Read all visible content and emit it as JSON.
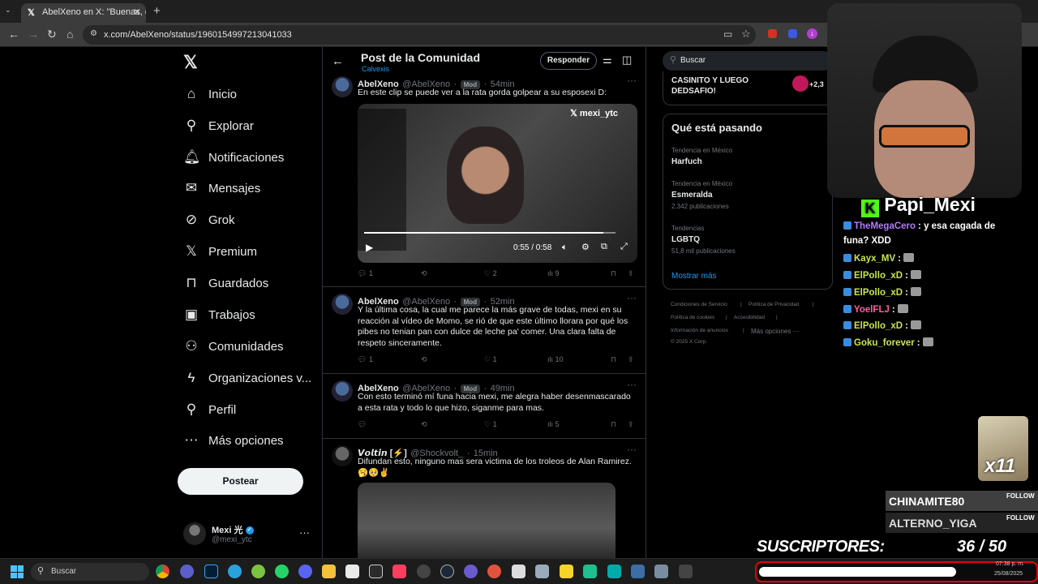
{
  "browser": {
    "tab_title": "AbelXeno en X: \"Buenas, q",
    "url": "x.com/AbelXeno/status/1960154997213041033"
  },
  "nav": {
    "items": [
      {
        "label": "Inicio",
        "icon": "home-icon",
        "glyph": "⌂"
      },
      {
        "label": "Explorar",
        "icon": "search-icon",
        "glyph": "⚲"
      },
      {
        "label": "Notificaciones",
        "icon": "bell-icon",
        "glyph": "🔔︎"
      },
      {
        "label": "Mensajes",
        "icon": "mail-icon",
        "glyph": "✉"
      },
      {
        "label": "Grok",
        "icon": "grok-icon",
        "glyph": "⊘"
      },
      {
        "label": "Premium",
        "icon": "x-logo-icon",
        "glyph": "𝕏"
      },
      {
        "label": "Guardados",
        "icon": "bookmark-icon",
        "glyph": "⊓"
      },
      {
        "label": "Trabajos",
        "icon": "briefcase-icon",
        "glyph": "▣"
      },
      {
        "label": "Comunidades",
        "icon": "people-icon",
        "glyph": "⚇"
      },
      {
        "label": "Organizaciones v...",
        "icon": "lightning-icon",
        "glyph": "ϟ"
      },
      {
        "label": "Perfil",
        "icon": "person-icon",
        "glyph": "⚲"
      },
      {
        "label": "Más opciones",
        "icon": "more-circle-icon",
        "glyph": "⋯"
      }
    ],
    "post_button": "Postear",
    "account_name": "Mexi 光",
    "account_handle": "@mexi_ytc"
  },
  "header": {
    "title": "Post de la Comunidad",
    "community": "Calvexis",
    "reply_button": "Responder"
  },
  "posts": [
    {
      "name": "AbelXeno",
      "handle": "@AbelXeno",
      "badge": "Mod",
      "time": "54min",
      "text": "En este clip se puede ver a la rata gorda golpear a su esposexi D:",
      "video_watermark": "mexi_ytc",
      "video_time": "0:55 / 0:58",
      "video_progress": 0.95,
      "replies": "1",
      "retweets": "",
      "likes": "2",
      "views": "9"
    },
    {
      "name": "AbelXeno",
      "handle": "@AbelXeno",
      "badge": "Mod",
      "time": "52min",
      "text": "Y la última cosa, la cual me parece la más grave de todas, mexi en su reacción al vídeo de Momo, se rió de que este último llorara por qué los pibes no tenian pan con dulce de leche pa' comer. Una clara falta de respeto sinceramente.",
      "replies": "1",
      "retweets": "",
      "likes": "1",
      "views": "10"
    },
    {
      "name": "AbelXeno",
      "handle": "@AbelXeno",
      "badge": "Mod",
      "time": "49min",
      "text": "Con esto terminó mí funa hacia mexi, me alegra haber desenmascarado a esta rata y todo lo que hizo, siganme para mas.",
      "replies": "",
      "retweets": "",
      "likes": "1",
      "views": "5"
    },
    {
      "name": "𝙑𝙤𝙡𝙩𝙞𝙣 [⚡]",
      "handle": "@Shockvolt_",
      "time": "15min",
      "text": "Difundan esto, ninguno mas sera victima de los troleos de Alan Ramirez. 🥱🥺✌"
    }
  ],
  "right": {
    "search_placeholder": "Buscar",
    "promo_text_1": "CASINITO Y LUEGO",
    "promo_text_2": "DEDSAFIO!",
    "promo_count": "+2,3",
    "trends_title": "Qué está pasando",
    "trends": [
      {
        "context": "Tendencia en México",
        "name": "Harfuch",
        "count": ""
      },
      {
        "context": "Tendencia en México",
        "name": "Esmeralda",
        "count": "2.342 publicaciones"
      },
      {
        "context": "Tendencias",
        "name": "LGBTQ",
        "count": "51,8 mil publicaciones"
      }
    ],
    "show_more": "Mostrar más",
    "footer": {
      "terms": "Condiciones de Servicio",
      "privacy": "Política de Privacidad",
      "cookies": "Política de cookies",
      "accessibility": "Accesibilidad",
      "ads": "Información de anuncios",
      "more": "Más opciones ···",
      "copyright": "© 2025 X Corp."
    }
  },
  "stream": {
    "streamer_name": "Papi_Mexi",
    "chat": [
      {
        "user": "TheMegaCero",
        "msg": ": y esa cagada de",
        "msg2": "funa? XDD",
        "color": "#b07cff"
      },
      {
        "user": "Kayx_MV",
        "msg": ":",
        "color": "#c8e64b"
      },
      {
        "user": "ElPollo_xD",
        "msg": ":",
        "color": "#c8e64b"
      },
      {
        "user": "ElPollo_xD",
        "msg": ":",
        "color": "#c8e64b"
      },
      {
        "user": "YoelFLJ",
        "msg": ":",
        "color": "#ff5fa2"
      },
      {
        "user": "ElPollo_xD",
        "msg": ":",
        "color": "#c8e64b"
      },
      {
        "user": "Goku_forever",
        "msg": ":",
        "color": "#c8e64b"
      }
    ],
    "emote_count": "x11",
    "follows": [
      {
        "name": "CHINAMITE80",
        "tag": "FOLLOW"
      },
      {
        "name": "ALTERNO_YIGA",
        "tag": "FOLLOW"
      }
    ],
    "subs_label": "SUSCRIPTORES:",
    "subs_value": "36 / 50",
    "subs_progress": 0.72
  },
  "taskbar": {
    "search": "Buscar",
    "time": "07:38 p. m.",
    "date": "25/08/2025"
  },
  "colors": {
    "x_blue": "#1d9bf0",
    "kick_green": "#53fc18"
  }
}
